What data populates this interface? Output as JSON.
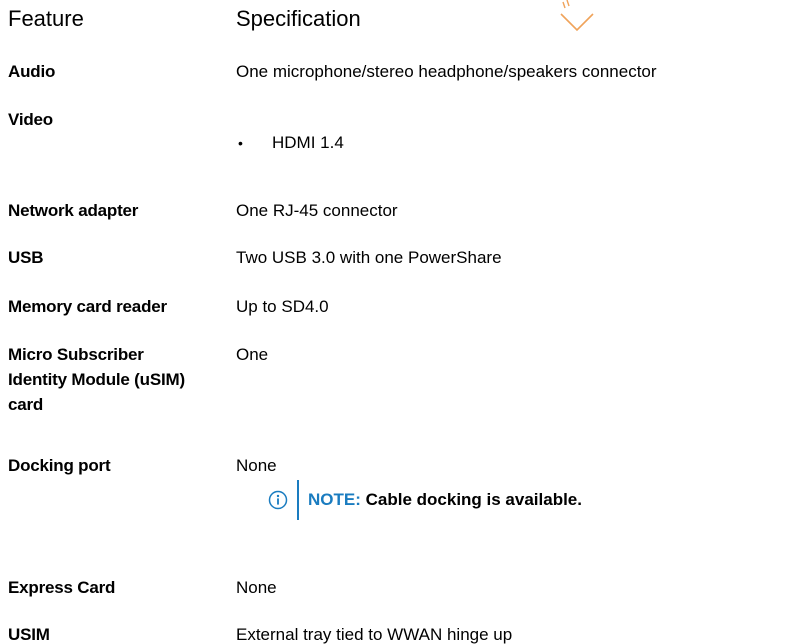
{
  "columns": {
    "feature": "Feature",
    "specification": "Specification"
  },
  "rows": [
    {
      "feature": "Audio",
      "value": "One microphone/stereo headphone/speakers connector"
    },
    {
      "feature": "Video",
      "value": "",
      "bullets": [
        "HDMI 1.4"
      ]
    },
    {
      "feature": "Network adapter",
      "value": "One RJ-45 connector"
    },
    {
      "feature": "USB",
      "value": "Two USB 3.0 with one PowerShare"
    },
    {
      "feature": "Memory card reader",
      "value": "Up to SD4.0"
    },
    {
      "feature": "Micro Subscriber Identity Module (uSIM) card",
      "value": "One"
    },
    {
      "feature": "Docking port",
      "value": "None"
    },
    {
      "feature": "Express Card",
      "value": "None"
    },
    {
      "feature": "USIM",
      "value": "External tray tied to WWAN hinge up"
    }
  ],
  "note": {
    "label": "NOTE:",
    "text": "Cable docking is available.",
    "icon": "info-icon"
  },
  "colors": {
    "note_accent": "#1a7cc0",
    "watermark": "#f0a35a"
  }
}
